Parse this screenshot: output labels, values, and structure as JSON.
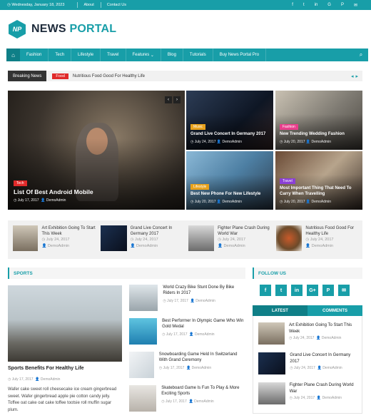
{
  "topbar": {
    "date": "Wednesday, January 18, 2023",
    "links": [
      "About",
      "Contact Us"
    ],
    "social_icons": [
      "facebook-icon",
      "twitter-icon",
      "linkedin-icon",
      "google-plus-icon",
      "pinterest-icon",
      "mail-icon"
    ]
  },
  "logo": {
    "mark": "NP",
    "word1": "NEWS",
    "word2": "PORTAL"
  },
  "nav": {
    "items": [
      "Fashion",
      "Tech",
      "Lifestyle",
      "Travel",
      "Features",
      "Blog",
      "Tutorials",
      "Buy News Portal Pro"
    ]
  },
  "breaking": {
    "label": "Breaking News",
    "tag": "Food",
    "text": "Nutritious Food Good For Healthy Life"
  },
  "featured": {
    "main": {
      "category": "Tech",
      "title": "List Of Best Android Mobile",
      "date": "July 17, 2017",
      "author": "DemoAdmin"
    },
    "grid": [
      {
        "category": "Music",
        "cat_color": "#e8a21d",
        "title": "Grand Live Concert In Germany 2017",
        "date": "July 24, 2017",
        "author": "DemoAdmin"
      },
      {
        "category": "Fashion",
        "cat_color": "#e83e8c",
        "title": "New Trending Wedding Fashion",
        "date": "July 20, 2017",
        "author": "DemoAdmin"
      },
      {
        "category": "Lifestyle",
        "cat_color": "#e8a21d",
        "title": "Best New Phone For New Lifestyle",
        "date": "July 20, 2017",
        "author": "DemoAdmin"
      },
      {
        "category": "Travel",
        "cat_color": "#8b3fd6",
        "title": "Most Important Thing That Need To Carry When Travelling",
        "date": "July 20, 2017",
        "author": "DemoAdmin"
      }
    ]
  },
  "strip": [
    {
      "title": "Art Exhibition Going To Start This Week",
      "date": "July 24, 2017",
      "author": "DemoAdmin"
    },
    {
      "title": "Grand Live Concert In Germany 2017",
      "date": "July 24, 2017",
      "author": "DemoAdmin"
    },
    {
      "title": "Fighter Plane Crash During World War",
      "date": "July 24, 2017",
      "author": "DemoAdmin"
    },
    {
      "title": "Nutritious Food Good For Healthy Life",
      "date": "July 24, 2017",
      "author": "DemoAdmin"
    }
  ],
  "sports": {
    "heading": "SPORTS",
    "main": {
      "title": "Sports Benefits For Healthy Life",
      "date": "July 17, 2017",
      "author": "DemoAdmin",
      "excerpt": "Wafer cake sweet roll cheesecake ice cream gingerbread sweet. Wafer gingerbread apple pie cotton candy jelly. Toffee oat cake oat cake toffee tootsie roll muffin sugar plum."
    },
    "list": [
      {
        "title": "World Crazy Bike Stunt Done By Bike Riders In 2017",
        "date": "July 17, 2017",
        "author": "DemoAdmin"
      },
      {
        "title": "Best Performer In Olympic Game Who Win Gold Medal",
        "date": "July 17, 2017",
        "author": "DemoAdmin"
      },
      {
        "title": "Snowboarding Game Held In Switzerland With Grand Ceremony",
        "date": "July 17, 2017",
        "author": "DemoAdmin"
      },
      {
        "title": "Skateboard Game Is Fun To Play & More Exciting Sports",
        "date": "July 17, 2017",
        "author": "DemoAdmin"
      }
    ]
  },
  "follow": {
    "heading": "FOLLOW US",
    "icons": [
      "f",
      "t",
      "in",
      "G+",
      "P",
      "✉"
    ]
  },
  "tabs": {
    "latest": "LATEST",
    "comments": "COMMENTS"
  },
  "latest": [
    {
      "title": "Art Exhibition Going To Start This Week",
      "date": "July 24, 2017",
      "author": "DemoAdmin"
    },
    {
      "title": "Grand Live Concert In Germany 2017",
      "date": "July 24, 2017",
      "author": "DemoAdmin"
    },
    {
      "title": "Fighter Plane Crash During World War",
      "date": "July 24, 2017",
      "author": "DemoAdmin"
    }
  ],
  "colors": {
    "accent": "#189ea8",
    "breaking_tag": "#e02a2a",
    "tech": "#e02a2a"
  }
}
